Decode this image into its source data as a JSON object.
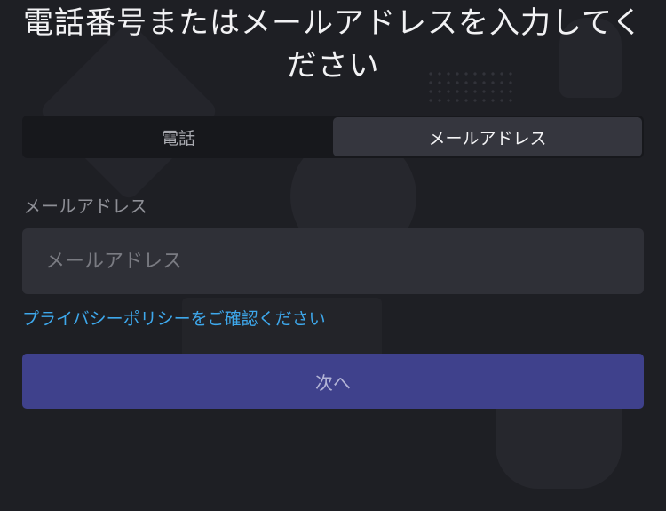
{
  "page": {
    "title": "電話番号またはメールアドレスを入力してください"
  },
  "tabs": [
    {
      "label": "電話",
      "active": false
    },
    {
      "label": "メールアドレス",
      "active": true
    }
  ],
  "email": {
    "label": "メールアドレス",
    "placeholder": "メールアドレス",
    "value": ""
  },
  "privacy_link": "プライバシーポリシーをご確認ください",
  "next_button": "次へ",
  "colors": {
    "background": "#1e1f24",
    "active_tab": "#35363e",
    "input_bg": "#2f3037",
    "link": "#3ea8ec",
    "primary_button": "#3f418c"
  }
}
